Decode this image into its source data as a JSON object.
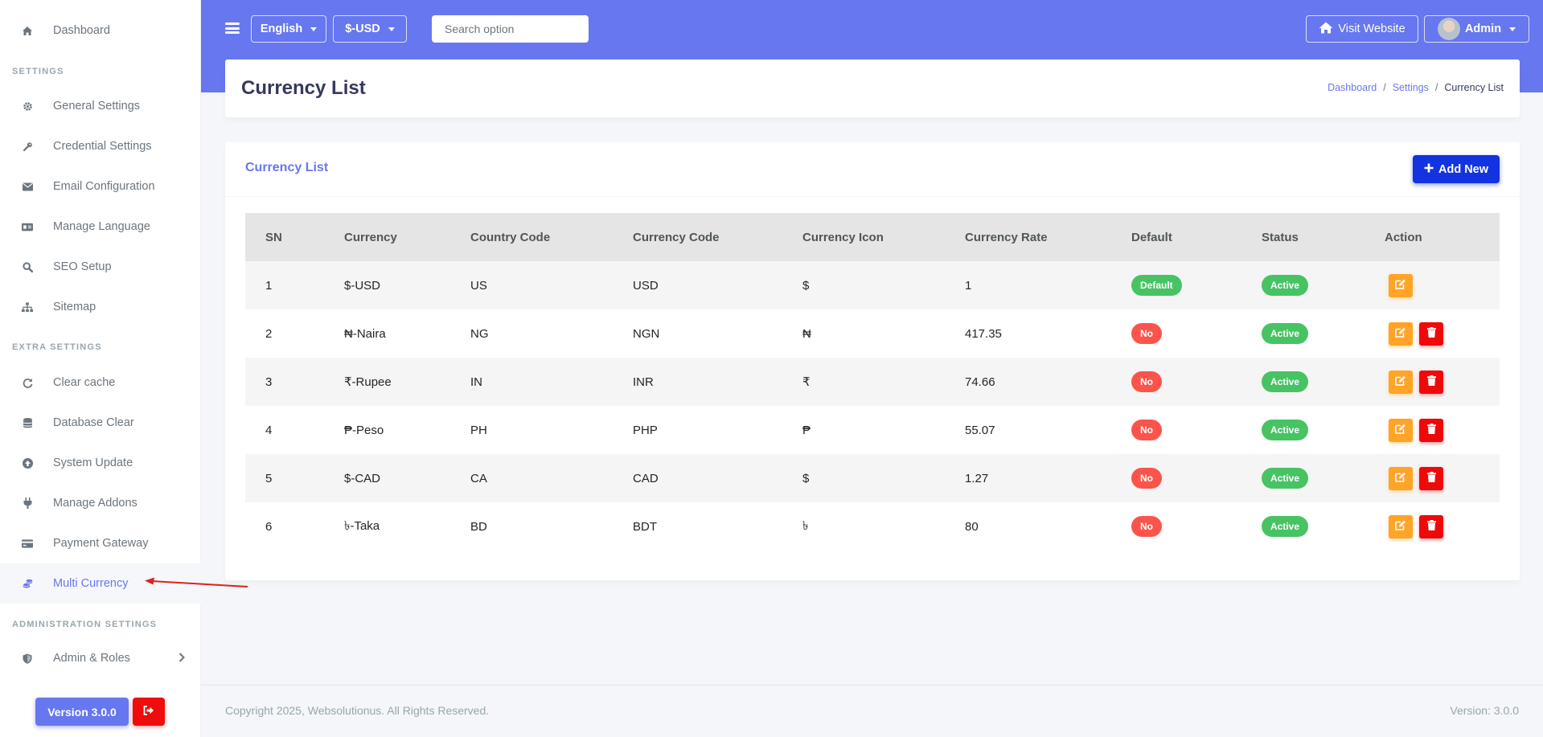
{
  "sidebar": {
    "dashboard": "Dashboard",
    "settings_head": "SETTINGS",
    "items_settings": [
      "General Settings",
      "Credential Settings",
      "Email Configuration",
      "Manage Language",
      "SEO Setup",
      "Sitemap"
    ],
    "extra_head": "EXTRA SETTINGS",
    "items_extra": [
      "Clear cache",
      "Database Clear",
      "System Update",
      "Manage Addons",
      "Payment Gateway",
      "Multi Currency"
    ],
    "admin_head": "ADMINISTRATION SETTINGS",
    "admin_roles": "Admin & Roles",
    "version_label": "Version 3.0.0"
  },
  "topbar": {
    "language": "English",
    "currency": "$-USD",
    "search_placeholder": "Search option",
    "visit_website": "Visit Website",
    "user": "Admin"
  },
  "header": {
    "title": "Currency List",
    "breadcrumb": [
      "Dashboard",
      "Settings",
      "Currency List"
    ]
  },
  "card": {
    "title": "Currency List",
    "add_new": "Add New"
  },
  "table": {
    "columns": [
      "SN",
      "Currency",
      "Country Code",
      "Currency Code",
      "Currency Icon",
      "Currency Rate",
      "Default",
      "Status",
      "Action"
    ],
    "rows": [
      {
        "sn": "1",
        "currency": "$-USD",
        "country": "US",
        "code": "USD",
        "icon": "$",
        "rate": "1",
        "default": "Default",
        "status": "Active",
        "deletable": false
      },
      {
        "sn": "2",
        "currency": "₦-Naira",
        "country": "NG",
        "code": "NGN",
        "icon": "₦",
        "rate": "417.35",
        "default": "No",
        "status": "Active",
        "deletable": true
      },
      {
        "sn": "3",
        "currency": "₹-Rupee",
        "country": "IN",
        "code": "INR",
        "icon": "₹",
        "rate": "74.66",
        "default": "No",
        "status": "Active",
        "deletable": true
      },
      {
        "sn": "4",
        "currency": "₱-Peso",
        "country": "PH",
        "code": "PHP",
        "icon": "₱",
        "rate": "55.07",
        "default": "No",
        "status": "Active",
        "deletable": true
      },
      {
        "sn": "5",
        "currency": "$-CAD",
        "country": "CA",
        "code": "CAD",
        "icon": "$",
        "rate": "1.27",
        "default": "No",
        "status": "Active",
        "deletable": true
      },
      {
        "sn": "6",
        "currency": "৳-Taka",
        "country": "BD",
        "code": "BDT",
        "icon": "৳",
        "rate": "80",
        "default": "No",
        "status": "Active",
        "deletable": true
      }
    ]
  },
  "footer": {
    "copyright": "Copyright 2025, Websolutionus. All Rights Reserved.",
    "version": "Version: 3.0.0"
  }
}
